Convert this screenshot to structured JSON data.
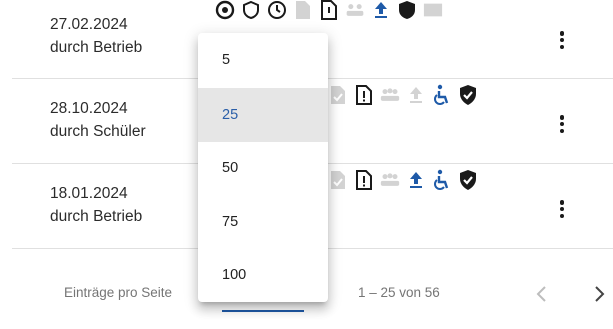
{
  "rows": [
    {
      "date": "27.02.2024",
      "source": "durch Betrieb"
    },
    {
      "date": "28.10.2024",
      "source": "durch Schüler"
    },
    {
      "date": "18.01.2024",
      "source": "durch Betrieb"
    }
  ],
  "row_icons": [
    "doc-check-icon",
    "doc-alert-icon",
    "people-icon",
    "upload-icon",
    "accessibility-icon",
    "shield-check-icon"
  ],
  "paginator": {
    "items_per_page_label": "Einträge pro Seite",
    "range_label": "1 – 25 von 56",
    "options": [
      "5",
      "25",
      "50",
      "75",
      "100"
    ],
    "selected": "25"
  },
  "colors": {
    "accent": "#1e5aa8",
    "icon_dark": "#1a1a1a",
    "icon_muted": "#c8c8c8",
    "icon_blue": "#1e5aa8"
  }
}
